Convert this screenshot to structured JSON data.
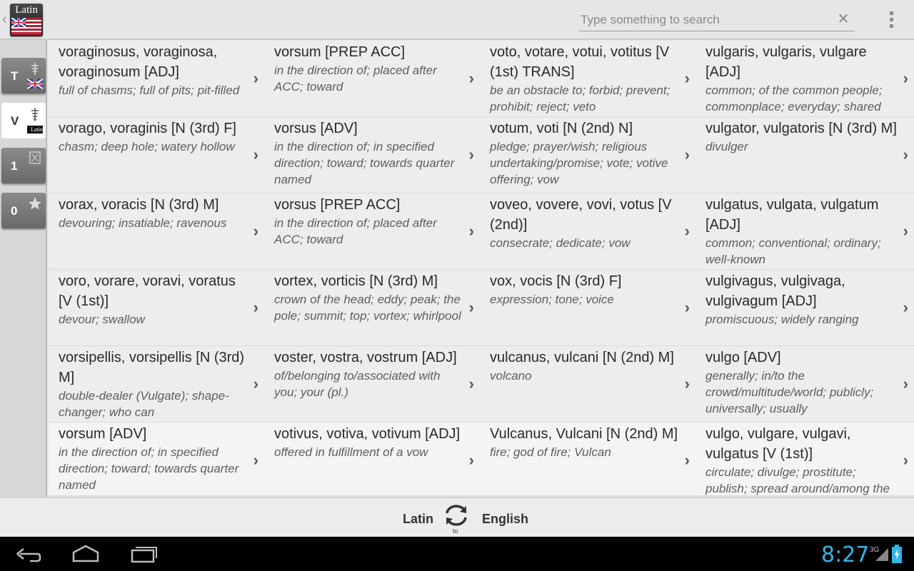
{
  "header": {
    "app_icon_text": "Latin",
    "search_placeholder": "Type something to search",
    "search_value": ""
  },
  "sidebar": {
    "tabs": [
      {
        "letter": "T",
        "icon": "translate-uk-flag-icon"
      },
      {
        "letter": "V",
        "icon": "latin-dictionary-icon",
        "icon_text": "Latin"
      },
      {
        "letter": "1",
        "icon": "history-icon"
      },
      {
        "letter": "0",
        "icon": "star-icon"
      }
    ]
  },
  "entries": [
    {
      "term": "voraginosus, voraginosa, voraginosum [ADJ]",
      "def": "full of chasms; full of pits; pit-filled"
    },
    {
      "term": "vorsum [PREP  ACC]",
      "def": "in the direction of; placed after ACC; toward"
    },
    {
      "term": "voto, votare, votui, votitus [V (1st) TRANS]",
      "def": "be an obstacle to; forbid; prevent; prohibit; reject; veto"
    },
    {
      "term": "vulgaris, vulgaris, vulgare [ADJ]",
      "def": "common; of the common people; commonplace; everyday; shared"
    },
    {
      "term": "vorago, voraginis [N (3rd) F]",
      "def": "chasm; deep hole; watery hollow"
    },
    {
      "term": "vorsus [ADV]",
      "def": "in the direction of; in specified direction; toward; towards quarter named"
    },
    {
      "term": "votum, voti [N (2nd) N]",
      "def": "pledge; prayer/wish; religious undertaking/promise; vote; votive offering; vow"
    },
    {
      "term": "vulgator, vulgatoris [N (3rd) M]",
      "def": "divulger"
    },
    {
      "term": "vorax, voracis [N (3rd) M]",
      "def": "devouring; insatiable; ravenous"
    },
    {
      "term": "vorsus [PREP  ACC]",
      "def": "in the direction of; placed after ACC; toward"
    },
    {
      "term": "voveo, vovere, vovi, votus [V (2nd)]",
      "def": "consecrate; dedicate; vow"
    },
    {
      "term": "vulgatus, vulgata, vulgatum [ADJ]",
      "def": "common; conventional; ordinary; well-known"
    },
    {
      "term": "voro, vorare, voravi, voratus [V (1st)]",
      "def": "devour; swallow"
    },
    {
      "term": "vortex, vorticis [N (3rd) M]",
      "def": "crown of the head; eddy; peak; the pole; summit; top; vortex; whirlpool"
    },
    {
      "term": "vox, vocis [N (3rd) F]",
      "def": "expression; tone; voice"
    },
    {
      "term": "vulgivagus, vulgivaga, vulgivagum [ADJ]",
      "def": "promiscuous; widely ranging"
    },
    {
      "term": "vorsipellis, vorsipellis [N (3rd) M]",
      "def": "double-dealer (Vulgate); shape-changer; who can"
    },
    {
      "term": "voster, vostra, vostrum [ADJ]",
      "def": "of/belonging to/associated with you; your (pl.)"
    },
    {
      "term": "vulcanus, vulcani [N (2nd) M]",
      "def": "volcano"
    },
    {
      "term": "vulgo [ADV]",
      "def": "generally; in/to the crowd/multitude/world; publicly; universally; usually"
    },
    {
      "term": "vorsum [ADV]",
      "def": "in the direction of; in specified direction; toward; towards quarter named"
    },
    {
      "term": "votivus, votiva, votivum [ADJ]",
      "def": "offered in fulfillment of a vow"
    },
    {
      "term": "Vulcanus, Vulcani [N (2nd) M]",
      "def": "fire; god of fire; Vulcan"
    },
    {
      "term": "vulgo, vulgare, vulgavi, vulgatus [V (1st)]",
      "def": "circulate; divulge; prostitute; publish; spread around/among the"
    }
  ],
  "chevron": "›",
  "language_bar": {
    "from": "Latin",
    "to": "English",
    "swap_label": "to"
  },
  "system_bar": {
    "time": "8:27",
    "network": "3G"
  },
  "colors": {
    "clock": "#33b5e5",
    "grid_bg": "#eeeced"
  }
}
